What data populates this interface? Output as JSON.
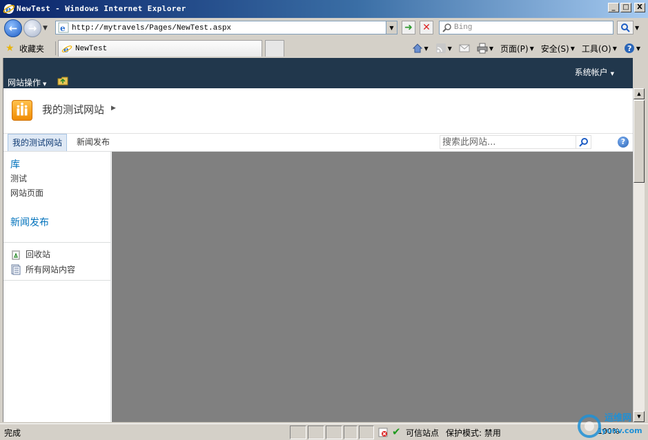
{
  "window": {
    "title": "NewTest - Windows Internet Explorer",
    "min": "_",
    "max": "□",
    "close": "X"
  },
  "address": {
    "url": "http://mytravels/Pages/NewTest.aspx",
    "search_placeholder": "Bing"
  },
  "favorites": {
    "label": "收藏夹",
    "tab_label": "NewTest",
    "commands": {
      "page": "页面(P)",
      "safety": "安全(S)",
      "tools": "工具(O)"
    }
  },
  "ribbon": {
    "site_actions": "网站操作",
    "account": "系统帐户"
  },
  "site": {
    "title": "我的测试网站"
  },
  "topnav": {
    "items": [
      {
        "label": "我的测试网站",
        "selected": true
      },
      {
        "label": "新闻发布",
        "selected": false
      }
    ],
    "search_placeholder": "搜索此网站..."
  },
  "quicklaunch": {
    "library_heading": "库",
    "library_items": [
      "测试",
      "网站页面"
    ],
    "news_heading": "新闻发布",
    "tools": [
      {
        "label": "回收站",
        "icon": "recycle-bin-icon"
      },
      {
        "label": "所有网站内容",
        "icon": "site-content-icon"
      }
    ]
  },
  "statusbar": {
    "status": "完成",
    "zone": "可信站点",
    "mode": "保护模式: 禁用",
    "zoom": "100%"
  },
  "watermark": {
    "text": "运维网",
    "sub": "iyunv.com"
  }
}
